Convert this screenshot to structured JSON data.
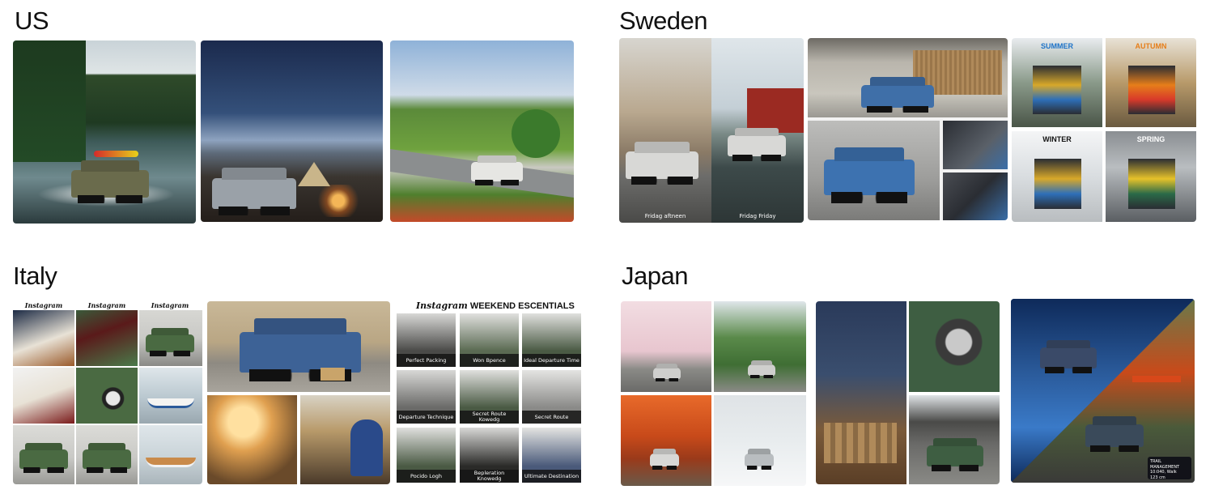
{
  "regions": {
    "us": {
      "title": "US"
    },
    "sweden": {
      "title": "Sweden",
      "captions": [
        "Fridag aftneen",
        "Fridag Friday"
      ],
      "seasons": [
        "SUMMER",
        "AUTUMN",
        "WINTER",
        "SPRING"
      ]
    },
    "italy": {
      "title": "Italy",
      "instagram_label": "Instagram",
      "weekend_title": "WEEKEND ESCENTIALS",
      "weekend_items": [
        "Perfect Packing",
        "Won Bpence",
        "Ideal Departure Time",
        "Departure Technique",
        "Secret Route Kowedg",
        "Secret Route",
        "Pocido Logh",
        "Bepleration Knowedg",
        "Ultimate Destination"
      ]
    },
    "japan": {
      "title": "Japan",
      "hud": {
        "title": "TRAIL MANAGEMENT",
        "line1": "10:040, Walk",
        "line2": "123 cm"
      }
    }
  },
  "colors": {
    "season_summer": "#1e73c8",
    "season_autumn": "#e67e1a",
    "season_winter": "#111111",
    "season_spring": "#ffffff"
  }
}
